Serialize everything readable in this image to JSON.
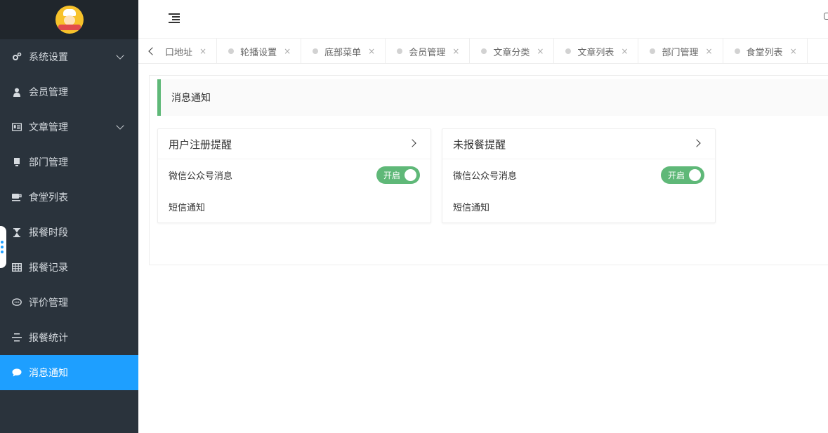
{
  "sidebar": {
    "items": [
      {
        "label": "系统设置",
        "icon": "gears-icon",
        "expandable": true
      },
      {
        "label": "会员管理",
        "icon": "user-icon",
        "expandable": false
      },
      {
        "label": "文章管理",
        "icon": "newspaper-icon",
        "expandable": true
      },
      {
        "label": "部门管理",
        "icon": "list-icon",
        "expandable": false
      },
      {
        "label": "食堂列表",
        "icon": "coffee-icon",
        "expandable": false
      },
      {
        "label": "报餐时段",
        "icon": "hourglass-icon",
        "expandable": false
      },
      {
        "label": "报餐记录",
        "icon": "table-icon",
        "expandable": false
      },
      {
        "label": "评价管理",
        "icon": "comment-icon",
        "expandable": false
      },
      {
        "label": "报餐统计",
        "icon": "align-icon",
        "expandable": false
      },
      {
        "label": "消息通知",
        "icon": "comment-filled-icon",
        "expandable": false,
        "active": true
      }
    ]
  },
  "tabs": [
    {
      "label": "口地址"
    },
    {
      "label": "轮播设置"
    },
    {
      "label": "底部菜单"
    },
    {
      "label": "会员管理"
    },
    {
      "label": "文章分类"
    },
    {
      "label": "文章列表"
    },
    {
      "label": "部门管理"
    },
    {
      "label": "食堂列表"
    }
  ],
  "tab_close": "×",
  "main": {
    "section_title": "消息通知",
    "cards": [
      {
        "title": "用户注册提醒",
        "row1_label": "微信公众号消息",
        "switch_label": "开启",
        "switch_on": true,
        "row2_label": "短信通知"
      },
      {
        "title": "未报餐提醒",
        "row1_label": "微信公众号消息",
        "switch_label": "开启",
        "switch_on": true,
        "row2_label": "短信通知"
      }
    ]
  },
  "colors": {
    "sidebar_bg": "#2a333c",
    "active_bg": "#1e9fff",
    "accent_green": "#5fb878"
  }
}
